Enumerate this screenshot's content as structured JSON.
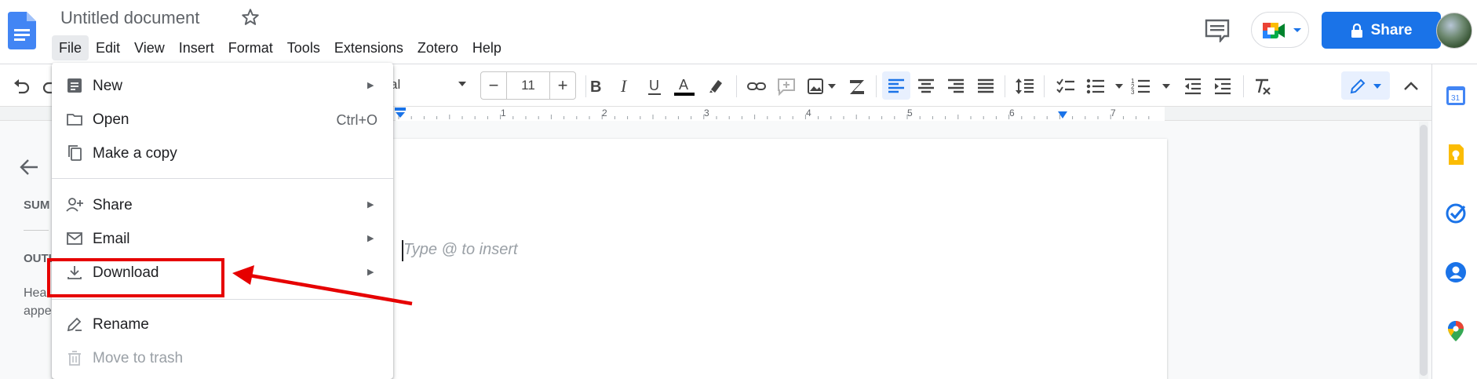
{
  "doc": {
    "title": "Untitled document"
  },
  "menubar": [
    "File",
    "Edit",
    "View",
    "Insert",
    "Format",
    "Tools",
    "Extensions",
    "Zotero",
    "Help"
  ],
  "header": {
    "share_label": "Share"
  },
  "toolbar": {
    "font_name": "al",
    "font_size": "11",
    "size_minus": "−",
    "size_plus": "+"
  },
  "ruler": {
    "numbers": [
      "1",
      "2",
      "3",
      "4",
      "5",
      "6",
      "7"
    ]
  },
  "outline": {
    "summary_label": "SUM",
    "outline_label": "OUTL",
    "desc_line1": "Hea",
    "desc_line2": "appe"
  },
  "document": {
    "placeholder": "Type @ to insert"
  },
  "file_menu": {
    "items": [
      {
        "label": "New",
        "icon": "new-doc-icon",
        "submenu": true
      },
      {
        "label": "Open",
        "icon": "folder-icon",
        "shortcut": "Ctrl+O"
      },
      {
        "label": "Make a copy",
        "icon": "copy-icon"
      },
      {
        "label": "Share",
        "icon": "person-add-icon",
        "submenu": true
      },
      {
        "label": "Email",
        "icon": "mail-icon",
        "submenu": true
      },
      {
        "label": "Download",
        "icon": "download-icon",
        "submenu": true
      },
      {
        "label": "Rename",
        "icon": "rename-icon"
      },
      {
        "label": "Move to trash",
        "icon": "trash-icon",
        "disabled": true
      }
    ]
  },
  "colors": {
    "accent": "#1a73e8",
    "annotation": "#e60000"
  }
}
